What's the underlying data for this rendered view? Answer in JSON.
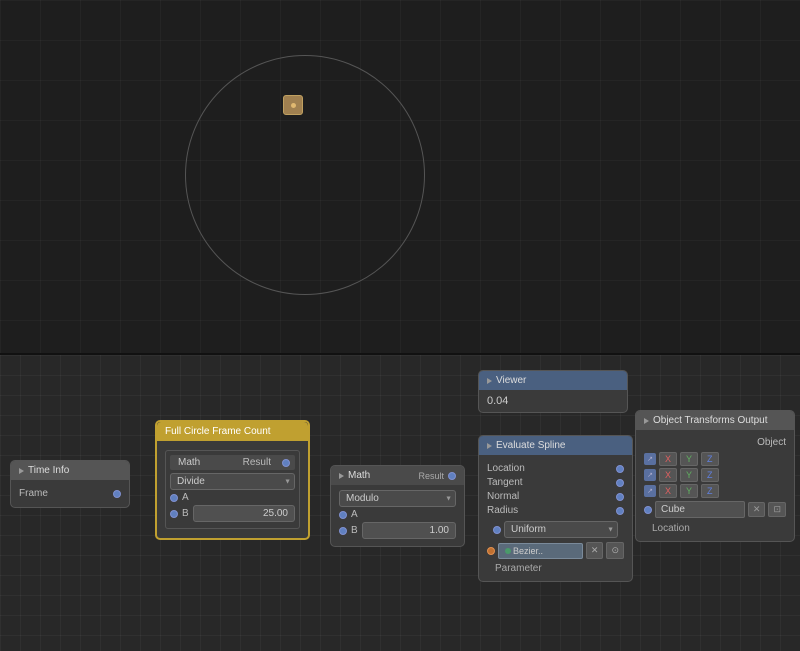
{
  "viewport": {
    "bg_color": "#1e1e1e"
  },
  "nodes": {
    "time_info": {
      "header": "Time Info",
      "output": "Frame"
    },
    "full_circle": {
      "header": "Full Circle Frame Count",
      "inner_header": "Math",
      "result_label": "Result",
      "operation": "Divide",
      "a_label": "A",
      "b_label": "B",
      "b_value": "25.00"
    },
    "math": {
      "header": "Math",
      "result_label": "Result",
      "operation": "Modulo",
      "a_label": "A",
      "b_label": "B",
      "b_value": "1.00"
    },
    "viewer": {
      "header": "Viewer",
      "value": "0.04"
    },
    "evaluate_spline": {
      "header": "Evaluate Spline",
      "location": "Location",
      "tangent": "Tangent",
      "normal": "Normal",
      "radius": "Radius",
      "uniform": "Uniform",
      "bezier_label": "Bezier..",
      "parameter": "Parameter"
    },
    "object_transforms": {
      "header": "Object Transforms Output",
      "object_label": "Object",
      "x": "X",
      "y": "Y",
      "z": "Z",
      "cube": "Cube",
      "location": "Location"
    }
  }
}
